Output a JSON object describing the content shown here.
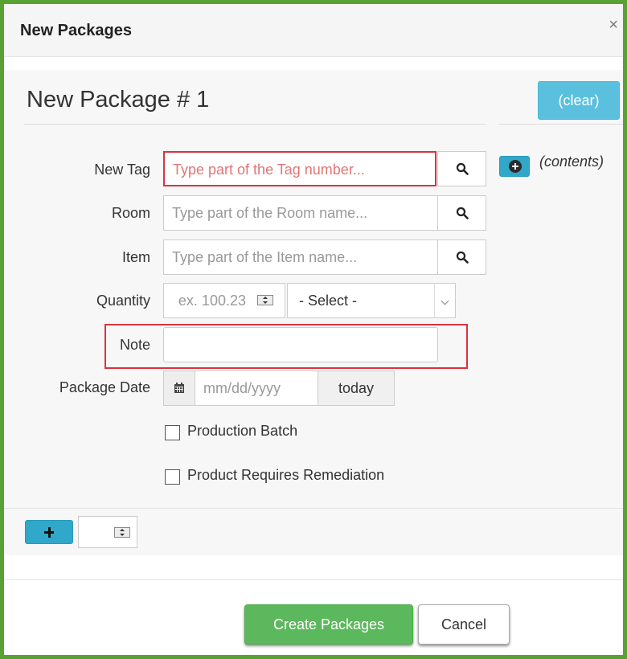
{
  "modal": {
    "title": "New Packages",
    "close_glyph": "×"
  },
  "package": {
    "title": "New Package # 1",
    "clear_label": "(clear)",
    "contents_label": "(contents)",
    "contents_icon": "plus-circle-icon"
  },
  "fields": {
    "new_tag": {
      "label": "New Tag",
      "placeholder": "Type part of the Tag number..."
    },
    "room": {
      "label": "Room",
      "placeholder": "Type part of the Room name..."
    },
    "item": {
      "label": "Item",
      "placeholder": "Type part of the Item name..."
    },
    "quantity": {
      "label": "Quantity",
      "placeholder": "ex. 100.23",
      "visible_text": "ex. 100.23",
      "unit_selected": "- Select -"
    },
    "note": {
      "label": "Note",
      "value": ""
    },
    "package_date": {
      "label": "Package Date",
      "placeholder": "mm/dd/yyyy",
      "today_label": "today"
    }
  },
  "checkboxes": [
    {
      "label": "Production Batch",
      "checked": false
    },
    {
      "label": "Product Requires Remediation",
      "checked": false
    }
  ],
  "footer": {
    "create_label": "Create Packages",
    "cancel_label": "Cancel"
  },
  "colors": {
    "frame_border": "#5aa133",
    "info_button": "#5bc0de",
    "success_button": "#5cb85c",
    "highlight_outline": "#d9333f",
    "placeholder_red": "#e07575"
  }
}
